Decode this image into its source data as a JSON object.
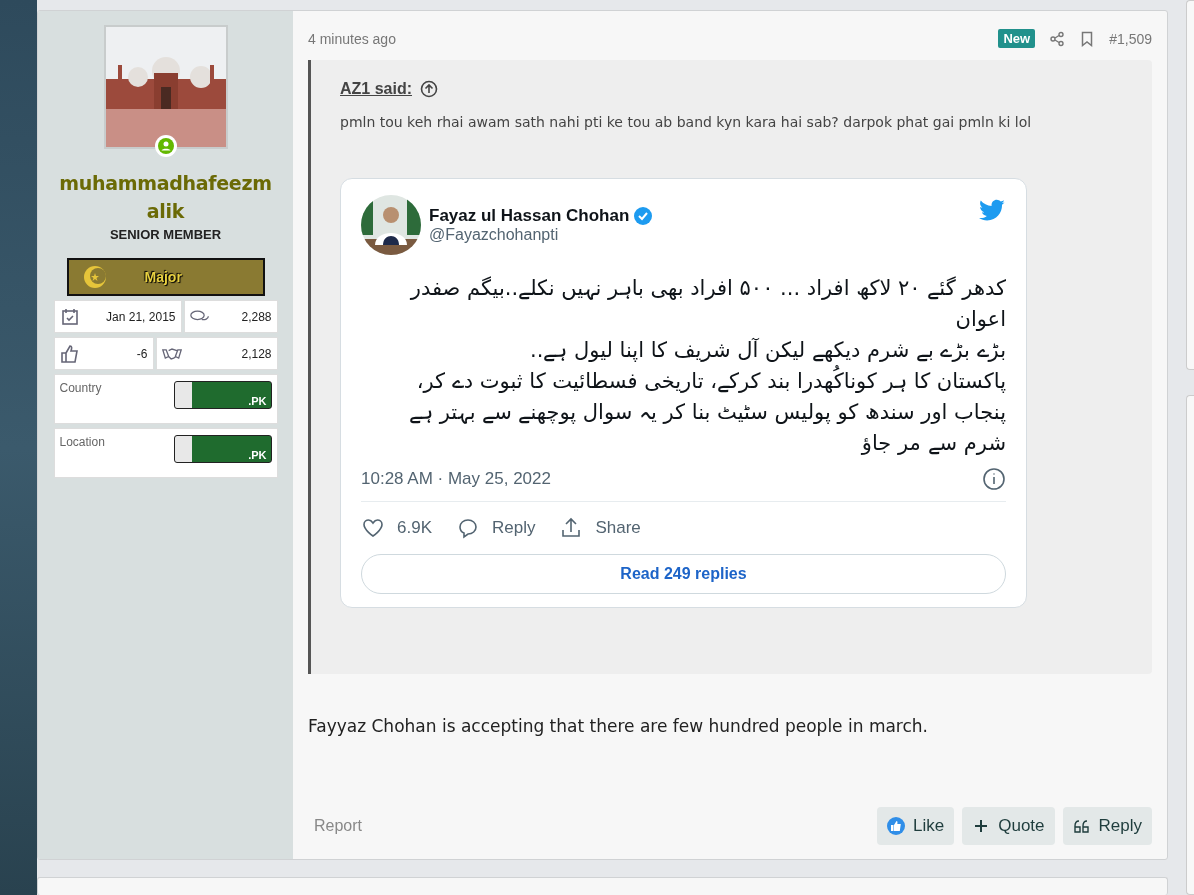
{
  "author": {
    "name": "muhammadhafeezmalik",
    "title": "SENIOR MEMBER",
    "online": true,
    "rank": "Major",
    "stats": [
      {
        "kind": "joined",
        "value": "Jan 21, 2015"
      },
      {
        "kind": "messages",
        "value": "2,288"
      },
      {
        "kind": "reactions",
        "value": "-6"
      },
      {
        "kind": "points",
        "value": "2,128"
      }
    ],
    "fields": [
      {
        "label": "Country",
        "flag": ".PK"
      },
      {
        "label": "Location",
        "flag": ".PK"
      }
    ]
  },
  "post": {
    "time": "4 minutes ago",
    "new_badge": "New",
    "number": "#1,509",
    "quote": {
      "author": "AZ1 said:",
      "text": "pmln tou keh rhai awam sath nahi pti ke tou ab band kyn kara hai sab? darpok phat gai pmln ki lol",
      "tweet": {
        "name": "Fayaz ul Hassan Chohan",
        "verified": true,
        "handle": "@Fayazchohanpti",
        "lines": [
          "کدھر گئے ۲۰ لاکھ افراد ... ۵۰۰ افراد بھی باہر نہیں نکلے..بیگم صفدر اعوان",
          "بڑے بڑے بے شرم دیکھے لیکن آل شریف کا اپنا لیول ہے..",
          "پاکستان کا ہر کوناکُھدرا بند کرکے، تاریخی فسطائیت کا ثبوت دے کر، پنجاب اور سندھ کو پولیس سٹیٹ بنا کر یہ سوال پوچھنے سے بہتر ہے شرم سے مر جاؤ"
        ],
        "date": "10:28 AM · May 25, 2022",
        "actions": [
          {
            "kind": "like",
            "label": "6.9K"
          },
          {
            "kind": "reply",
            "label": "Reply"
          },
          {
            "kind": "share",
            "label": "Share"
          }
        ],
        "replies": "Read 249 replies"
      }
    },
    "message": "Fayyaz Chohan is accepting that there are few hundred people in march.",
    "report": "Report",
    "buttons": [
      {
        "kind": "like",
        "label": "Like"
      },
      {
        "kind": "quote",
        "label": "Quote"
      },
      {
        "kind": "reply",
        "label": "Reply"
      }
    ]
  }
}
